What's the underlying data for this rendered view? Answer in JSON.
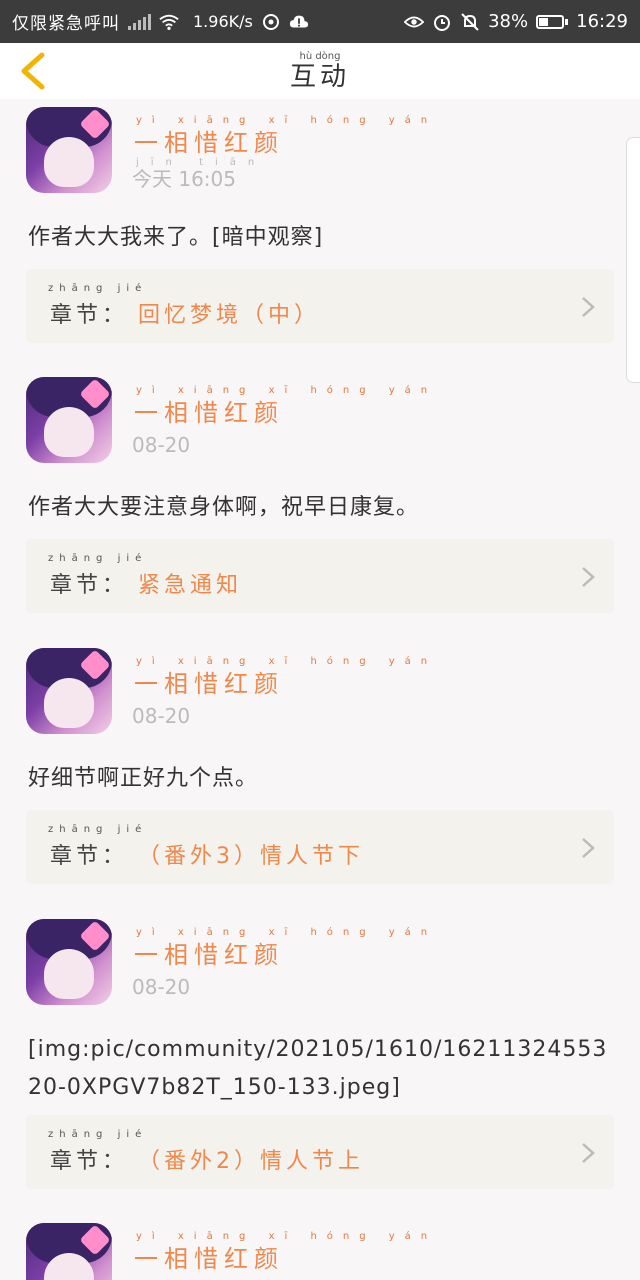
{
  "status_bar": {
    "carrier": "仅限紧急呼叫",
    "speed": "1.96K/s",
    "battery": "38%",
    "time": "16:29"
  },
  "header": {
    "title": "互动",
    "title_pinyin": "hù dòng",
    "back_icon": "chevron-left-icon"
  },
  "posts": [
    {
      "username": "一相惜红颜",
      "username_pinyin": "yì xiāng xī hóng yán",
      "time": "今天 16:05",
      "time_pinyin": "jīn tiān",
      "content": "作者大大我来了。[暗中观察]",
      "chapter_label": "章节：",
      "chapter_label_pinyin": "zhāng jié",
      "chapter_title": "回忆梦境（中）"
    },
    {
      "username": "一相惜红颜",
      "username_pinyin": "yì xiāng xī hóng yán",
      "time": "08-20",
      "content": "作者大大要注意身体啊，祝早日康复。",
      "chapter_label": "章节：",
      "chapter_label_pinyin": "zhāng jié",
      "chapter_title": "紧急通知"
    },
    {
      "username": "一相惜红颜",
      "username_pinyin": "yì xiāng xī hóng yán",
      "time": "08-20",
      "content": "好细节啊正好九个点。",
      "chapter_label": "章节：",
      "chapter_label_pinyin": "zhāng jié",
      "chapter_title": "（番外3）情人节下"
    },
    {
      "username": "一相惜红颜",
      "username_pinyin": "yì xiāng xī hóng yán",
      "time": "08-20",
      "content": "[img:pic/community/202105/1610/1621132455320-0XPGV7b82T_150-133.jpeg]",
      "chapter_label": "章节：",
      "chapter_label_pinyin": "zhāng jié",
      "chapter_title": "（番外2）情人节上"
    },
    {
      "username": "一相惜红颜",
      "username_pinyin": "yì xiāng xī hóng yán"
    }
  ],
  "colors": {
    "accent": "#f0884c",
    "status_bar": "#3c3c3c",
    "card_bg": "#f3f2ec",
    "page_bg": "#f8f6f6"
  }
}
